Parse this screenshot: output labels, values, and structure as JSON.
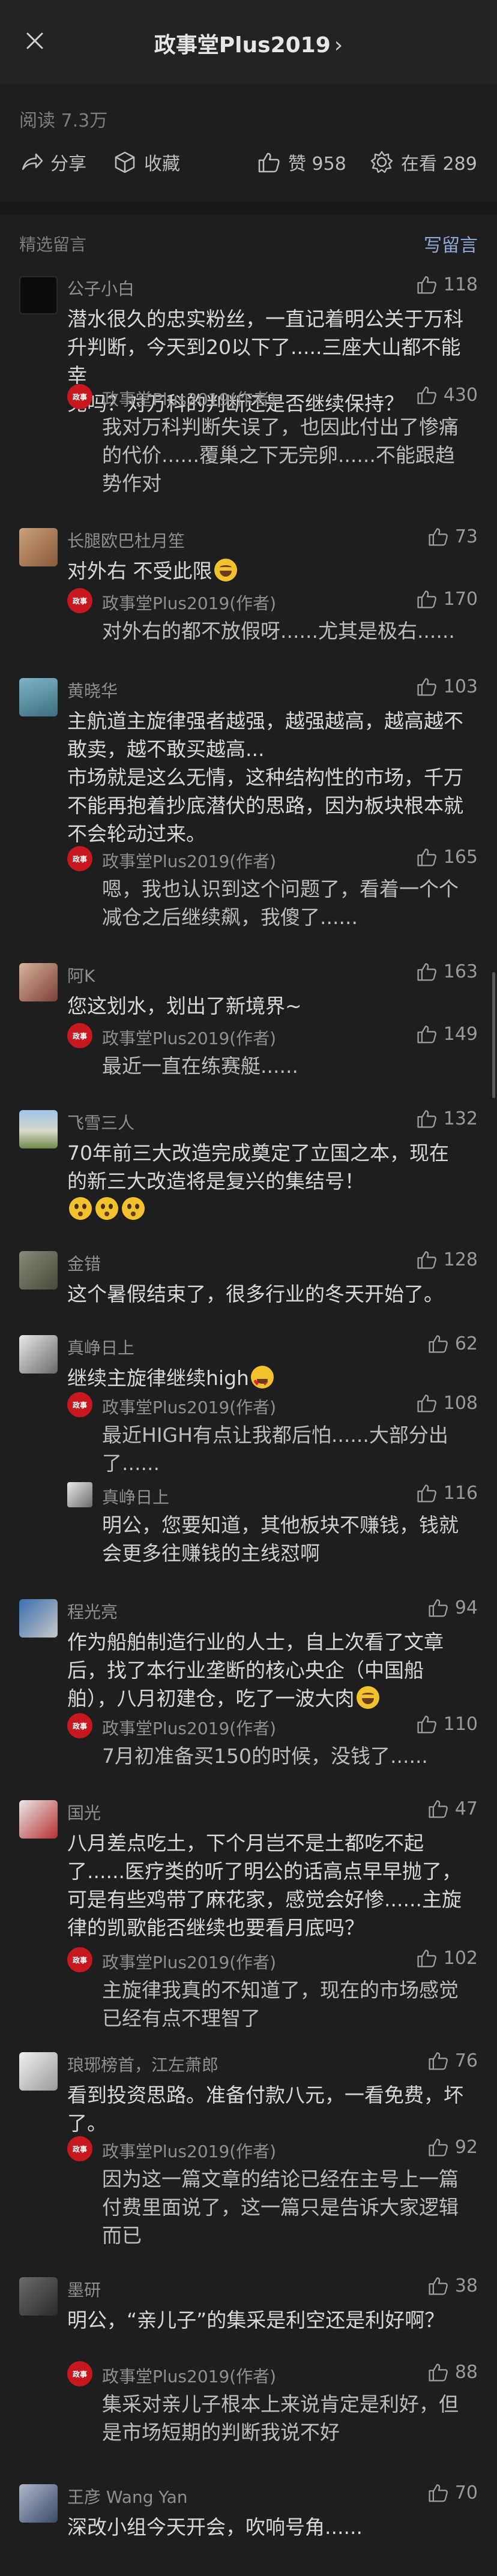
{
  "header": {
    "title": "政事堂Plus2019",
    "chevron": "›"
  },
  "stats": {
    "reads": "阅读 7.3万"
  },
  "actions": {
    "share": "分享",
    "favorite": "收藏",
    "like": "赞 958",
    "watching": "在看 289"
  },
  "section": {
    "title": "精选留言",
    "write_comment": "写留言"
  },
  "author_name": "政事堂Plus2019(作者)",
  "comments": [
    {
      "nick": "公子小白",
      "likes": "118",
      "text": [
        "潜水很久的忠实粉丝，一直记着明公关于万科",
        "升判断，今天到20以下了.....三座大山都不能幸",
        "免吗？对万科的判断还是否继续保持？"
      ],
      "reply_likes": "430",
      "reply": [
        "我对万科判断失误了，也因此付出了惨痛",
        "的代价......覆巢之下无完卵......不能跟趋",
        "势作对"
      ]
    },
    {
      "nick": "长腿欧巴杜月笙",
      "likes": "73",
      "text": [
        "对外右 不受此限"
      ],
      "reply_likes": "170",
      "reply": [
        "对外右的都不放假呀......尤其是极右......"
      ]
    },
    {
      "nick": "黄晓华",
      "likes": "103",
      "text": [
        "主航道主旋律强者越强，越强越高，越高越不",
        "敢卖，越不敢买越高...",
        "市场就是这么无情，这种结构性的市场，千万",
        "不能再抱着抄底潜伏的思路，因为板块根本就",
        "不会轮动过来。"
      ],
      "reply_likes": "165",
      "reply": [
        "嗯，我也认识到这个问题了，看着一个个",
        "减仓之后继续飙，我傻了......"
      ]
    },
    {
      "nick": "阿K",
      "likes": "163",
      "text": [
        "您这划水，划出了新境界~"
      ],
      "reply_likes": "149",
      "reply": [
        "最近一直在练赛艇......"
      ]
    },
    {
      "nick": "飞雪三人",
      "likes": "132",
      "text": [
        "70年前三大改造完成奠定了立国之本，现在",
        "的新三大改造将是复兴的集结号！",
        ""
      ],
      "reply_likes": "",
      "reply": []
    },
    {
      "nick": "金错",
      "likes": "128",
      "text": [
        "这个暑假结束了，很多行业的冬天开始了。"
      ],
      "reply_likes": "",
      "reply": []
    },
    {
      "nick": "真峥日上",
      "likes": "62",
      "text": [
        "继续主旋律继续high"
      ],
      "reply_likes": "108",
      "reply": [
        "最近HIGH有点让我都后怕......大部分出",
        "了......"
      ],
      "sub_nick": "真峥日上",
      "sub_likes": "116",
      "sub_text": [
        "明公，您要知道，其他板块不赚钱，钱就",
        "会更多往赚钱的主线怼啊"
      ]
    },
    {
      "nick": "程光亮",
      "likes": "94",
      "text": [
        "作为船舶制造行业的人士，自上次看了文章",
        "后，找了本行业垄断的核心央企（中国船",
        "舶），八月初建仓，吃了一波大肉"
      ],
      "reply_likes": "110",
      "reply": [
        "7月初准备买150的时候，没钱了......"
      ]
    },
    {
      "nick": "国光",
      "likes": "47",
      "text": [
        "八月差点吃土，下个月岂不是土都吃不起",
        "了......医疗类的听了明公的话高点早早抛了，",
        "可是有些鸡带了麻花家，感觉会好惨......主旋",
        "律的凯歌能否继续也要看月底吗？"
      ],
      "reply_likes": "102",
      "reply": [
        "主旋律我真的不知道了，现在的市场感觉",
        "已经有点不理智了"
      ]
    },
    {
      "nick": "琅琊榜首，江左萧郎",
      "likes": "76",
      "text": [
        "看到投资思路。准备付款八元，一看免费，坏",
        "了。"
      ],
      "reply_likes": "92",
      "reply": [
        "因为这一篇文章的结论已经在主号上一篇",
        "付费里面说了，这一篇只是告诉大家逻辑",
        "而已"
      ]
    },
    {
      "nick": "墨研",
      "likes": "38",
      "text": [
        "明公，“亲儿子”的集采是利空还是利好啊？"
      ],
      "reply_likes": "88",
      "reply": [
        "集采对亲儿子根本上来说肯定是利好，但",
        "是市场短期的判断我说不好"
      ]
    },
    {
      "nick": "王彦 Wang Yan",
      "likes": "70",
      "text": [
        "深改小组今天开会，吹响号角......"
      ],
      "reply_likes": "",
      "reply": []
    }
  ],
  "icons": {
    "close": "close-icon",
    "share": "share-icon",
    "favorite": "box-icon",
    "like": "thumb-up-icon",
    "watching": "gear-flower-icon"
  },
  "colors": {
    "background": "#1e1e1e",
    "author_avatar": "#c7171f",
    "link": "#8fa8d8"
  }
}
